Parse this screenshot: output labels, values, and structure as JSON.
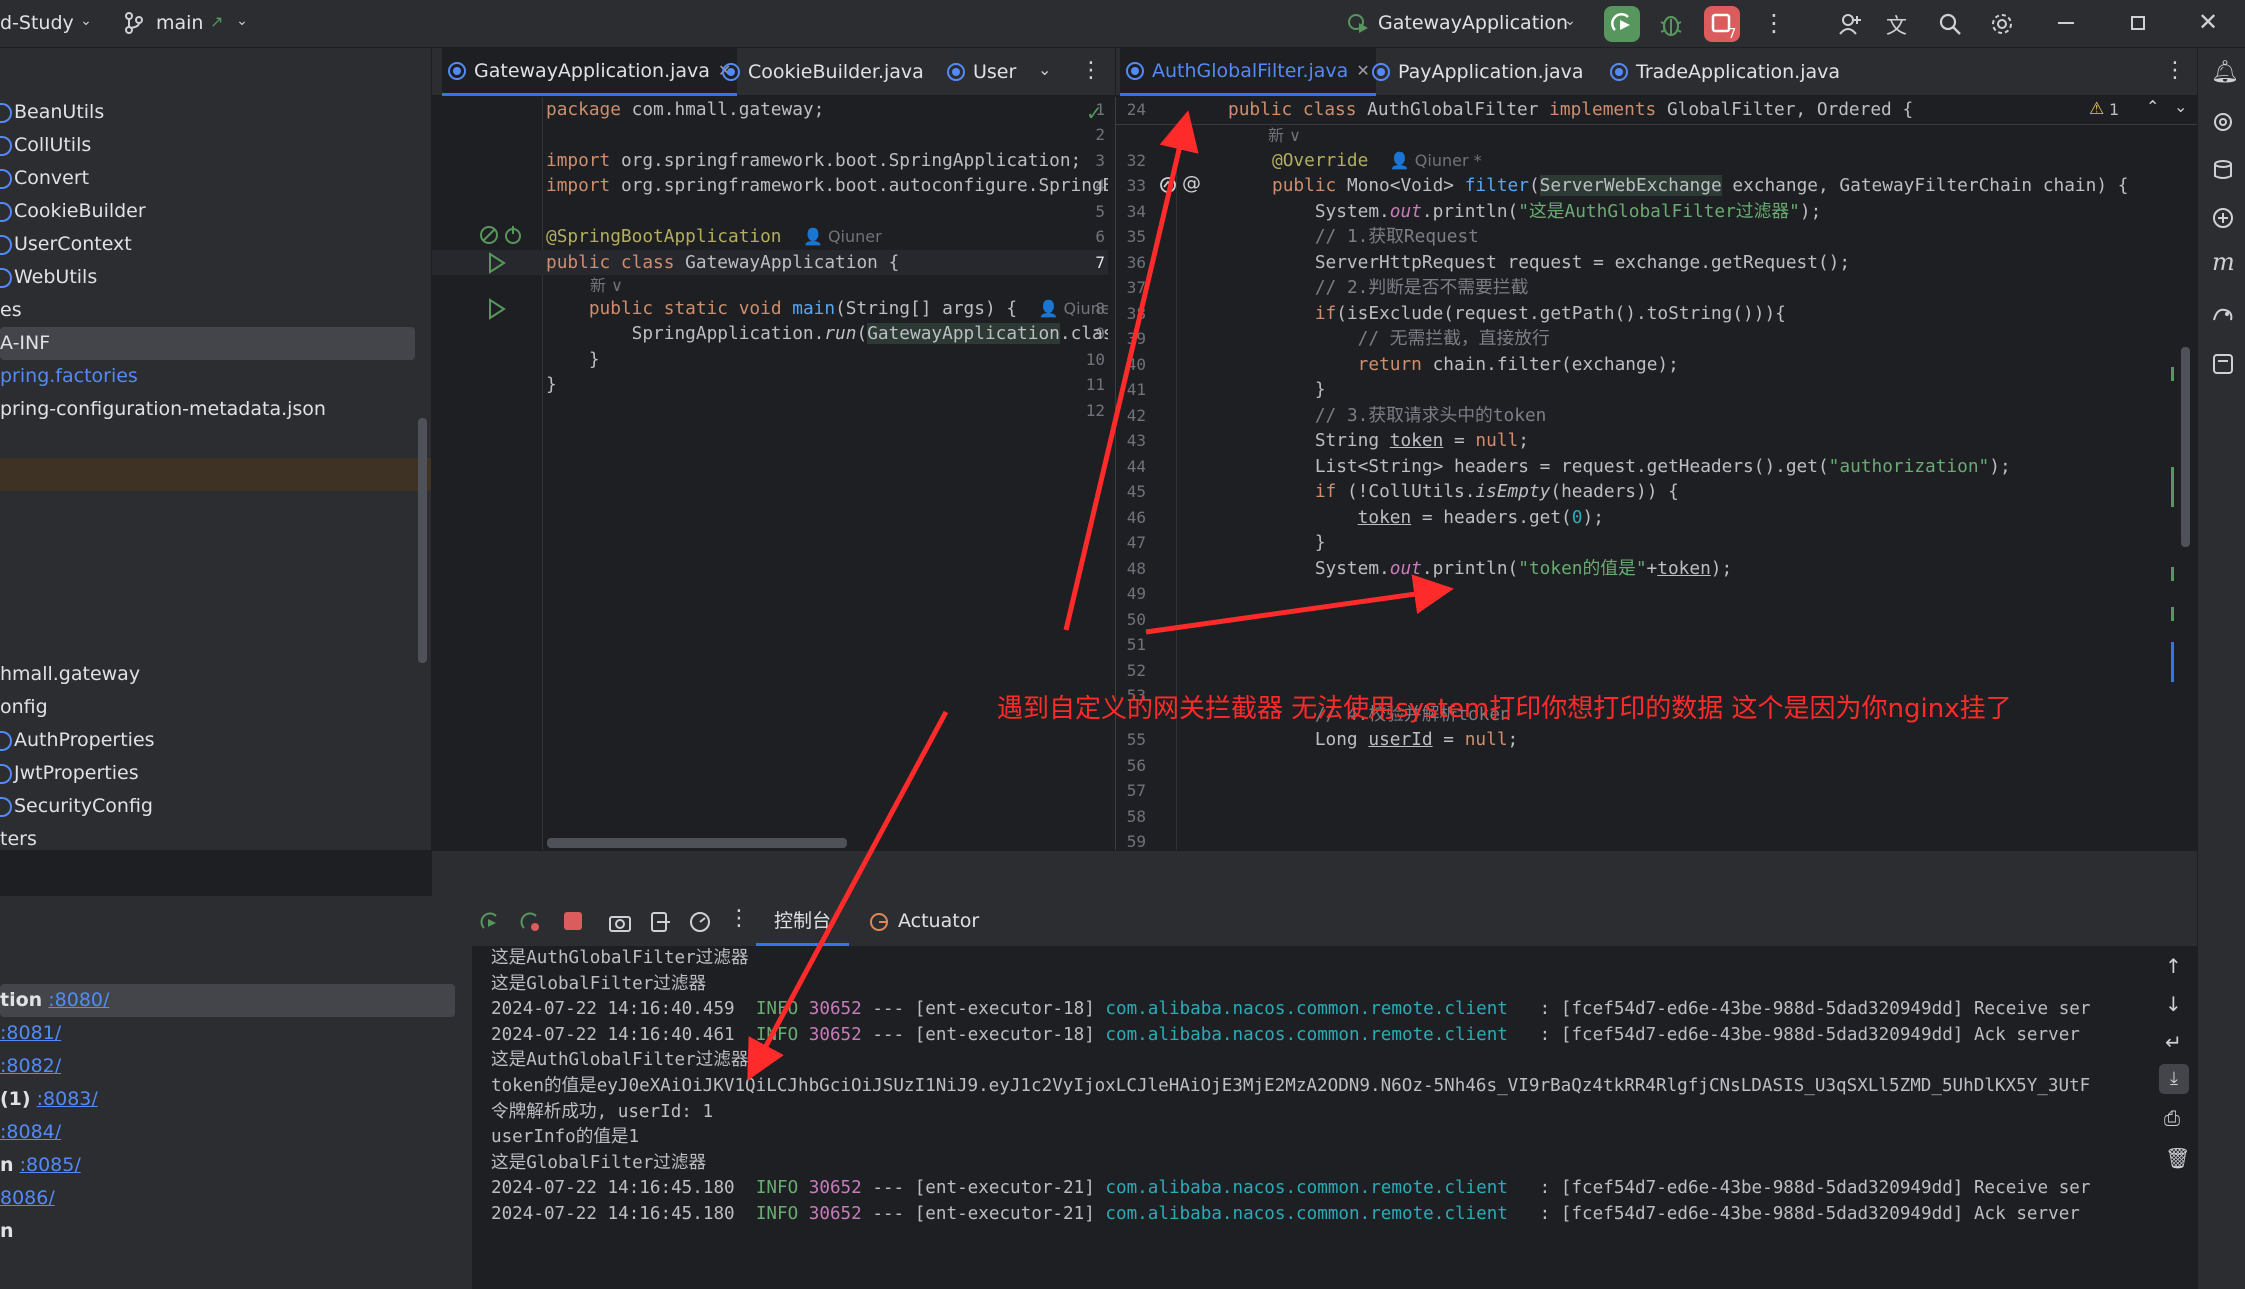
{
  "topbar": {
    "project": "d-Study",
    "branch": "main",
    "run_config": "GatewayApplication",
    "icons": [
      "chevron-down-icon",
      "branch-icon",
      "run-icon",
      "debug-icon",
      "stop-icon",
      "more-icon",
      "add-user-icon",
      "translate-icon",
      "search-icon",
      "gear-icon",
      "minimize-icon",
      "restore-icon",
      "close-icon"
    ]
  },
  "tree": {
    "items": [
      {
        "label": "BeanUtils",
        "icon": "class-icon"
      },
      {
        "label": "CollUtils",
        "icon": "class-icon"
      },
      {
        "label": "Convert",
        "icon": "class-icon"
      },
      {
        "label": "CookieBuilder",
        "icon": "class-icon"
      },
      {
        "label": "UserContext",
        "icon": "class-icon"
      },
      {
        "label": "WebUtils",
        "icon": "class-icon"
      },
      {
        "label": "es",
        "icon": ""
      },
      {
        "label": "A-INF",
        "icon": ""
      },
      {
        "label": "pring.factories",
        "icon": ""
      },
      {
        "label": "pring-configuration-metadata.json",
        "icon": ""
      },
      {
        "label": "hmall.gateway",
        "icon": ""
      },
      {
        "label": "onfig",
        "icon": ""
      },
      {
        "label": "AuthProperties",
        "icon": "class-icon"
      },
      {
        "label": "JwtProperties",
        "icon": "class-icon"
      },
      {
        "label": "SecurityConfig",
        "icon": "class-icon"
      },
      {
        "label": "ters",
        "icon": ""
      }
    ]
  },
  "left_editor": {
    "tabs": [
      "GatewayApplication.java",
      "CookieBuilder.java",
      "User"
    ],
    "author_hint": "Qiuner",
    "usage_hint": "新 ∨"
  },
  "right_editor": {
    "tabs": [
      "AuthGlobalFilter.java",
      "PayApplication.java",
      "TradeApplication.java"
    ],
    "author_hint": "Qiuner *",
    "warning_count": "1"
  },
  "bottom": {
    "tabs": [
      "控制台",
      "Actuator"
    ]
  },
  "services": [
    {
      "name": "tion",
      "port": ":8080/"
    },
    {
      "name": "",
      "port": ":8081/"
    },
    {
      "name": "",
      "port": ":8082/"
    },
    {
      "name": "(1)",
      "port": ":8083/"
    },
    {
      "name": "",
      "port": ":8084/"
    },
    {
      "name": "n",
      "port": ":8085/"
    },
    {
      "name": "",
      "port": "8086/"
    },
    {
      "name": "n",
      "port": ""
    }
  ],
  "console": {
    "lines": [
      {
        "kind": "plain",
        "text": "这是AuthGlobalFilter过滤器"
      },
      {
        "kind": "plain",
        "text": "这是GlobalFilter过滤器"
      },
      {
        "kind": "log",
        "time": "2024-07-22 14:16:40.459",
        "level": "INFO",
        "pid": "30652",
        "thread": "--- [ent-executor-18]",
        "logger": "com.alibaba.nacos.common.remote.client",
        "msg": "   : [fcef54d7-ed6e-43be-988d-5dad320949dd] Receive ser"
      },
      {
        "kind": "log",
        "time": "2024-07-22 14:16:40.461",
        "level": "INFO",
        "pid": "30652",
        "thread": "--- [ent-executor-18]",
        "logger": "com.alibaba.nacos.common.remote.client",
        "msg": "   : [fcef54d7-ed6e-43be-988d-5dad320949dd] Ack server"
      },
      {
        "kind": "plain",
        "text": "这是AuthGlobalFilter过滤器"
      },
      {
        "kind": "plain",
        "text": "token的值是eyJ0eXAiOiJKV1QiLCJhbGciOiJSUzI1NiJ9.eyJ1c2VyIjoxLCJleHAiOjE3MjE2MzA2ODN9.N6Oz-5Nh46s_VI9rBaQz4tkRR4RlgfjCNsLDASIS_U3qSXLl5ZMD_5UhDlKX5Y_3UtF"
      },
      {
        "kind": "plain",
        "text": "令牌解析成功, userId: 1"
      },
      {
        "kind": "plain",
        "text": "userInfo的值是1"
      },
      {
        "kind": "plain",
        "text": "这是GlobalFilter过滤器"
      },
      {
        "kind": "log",
        "time": "2024-07-22 14:16:45.180",
        "level": "INFO",
        "pid": "30652",
        "thread": "--- [ent-executor-21]",
        "logger": "com.alibaba.nacos.common.remote.client",
        "msg": "   : [fcef54d7-ed6e-43be-988d-5dad320949dd] Receive ser"
      },
      {
        "kind": "log",
        "time": "2024-07-22 14:16:45.180",
        "level": "INFO",
        "pid": "30652",
        "thread": "--- [ent-executor-21]",
        "logger": "com.alibaba.nacos.common.remote.client",
        "msg": "   : [fcef54d7-ed6e-43be-988d-5dad320949dd] Ack server"
      }
    ]
  },
  "annotation": {
    "text": "遇到自定义的网关拦截器 无法使用system打印你想打印的数据 这个是因为你nginx挂了",
    "color": "#ff2b2b"
  },
  "colors": {
    "accent": "#3574f0",
    "keyword": "#cf8e6d",
    "string": "#6aab73",
    "annotation_code": "#b3ae60",
    "function": "#56a8f5"
  }
}
